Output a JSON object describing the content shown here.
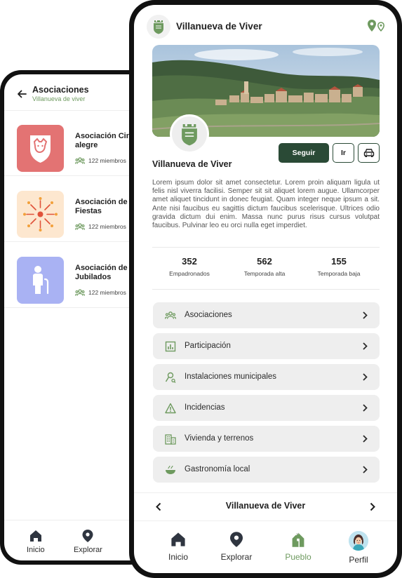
{
  "colors": {
    "accent_dark": "#2a4a36",
    "accent_green": "#6e9a5f",
    "menu_bg": "#eeeeee"
  },
  "back_screen": {
    "header": {
      "title": "Asociaciones",
      "subtitle": "Villanueva de viver",
      "back_icon": "arrow-left-icon"
    },
    "items": [
      {
        "name_line1": "Asociación Cine",
        "name_line2": "alegre",
        "members": "122 miembros",
        "thumb_color": "#e37373",
        "icon": "boar-shield-icon"
      },
      {
        "name_line1": "Asociación de e",
        "name_line2": "Fiestas",
        "members": "122 miembros",
        "thumb_color": "#fde7cf",
        "icon": "fireworks-icon"
      },
      {
        "name_line1": "Asociación de p",
        "name_line2": "Jubilados",
        "members": "122 miembros",
        "thumb_color": "#a9b2f3",
        "icon": "elder-person-icon"
      }
    ],
    "nav": [
      {
        "label": "Inicio",
        "icon": "home-icon"
      },
      {
        "label": "Explorar",
        "icon": "location-icon"
      }
    ]
  },
  "front_screen": {
    "top_bar": {
      "title": "Villanueva de Viver",
      "right_icon": "map-pins-icon"
    },
    "profile": {
      "name": "Villanueva de Viver",
      "follow_label": "Seguir",
      "go_label": "Ir",
      "car_icon": "car-icon",
      "description": "Lorem ipsum dolor sit amet consectetur. Lorem proin aliquam ligula ut felis nisl viverra facilisi. Semper sit sit aliquet lorem augue. Ullamcorper amet aliquet tincidunt in donec feugiat. Quam integer neque ipsum a sit. Ante nisi faucibus eu sagittis dictum faucibus scelerisque. Ultrices odio gravida dictum dui enim. Massa nunc purus risus cursus volutpat faucibus. Pulvinar leo eu orci nulla eget imperdiet."
    },
    "stats": [
      {
        "value": "352",
        "label": "Empadronados"
      },
      {
        "value": "562",
        "label": "Temporada alta"
      },
      {
        "value": "155",
        "label": "Temporada baja"
      }
    ],
    "menu": [
      {
        "label": "Asociaciones",
        "icon": "group-icon"
      },
      {
        "label": "Participación",
        "icon": "bar-chart-icon"
      },
      {
        "label": "Instalaciones municipales",
        "icon": "person-search-icon"
      },
      {
        "label": "Incidencias",
        "icon": "warning-icon"
      },
      {
        "label": "Vivienda y terrenos",
        "icon": "buildings-icon"
      },
      {
        "label": "Gastronomía local",
        "icon": "food-bowl-icon"
      }
    ],
    "pager": {
      "title": "Villanueva de Viver"
    },
    "nav": [
      {
        "label": "Inicio",
        "icon": "home-icon"
      },
      {
        "label": "Explorar",
        "icon": "location-icon"
      },
      {
        "label": "Pueblo",
        "icon": "town-icon",
        "active": true
      },
      {
        "label": "Perfil",
        "icon": "avatar"
      }
    ]
  }
}
